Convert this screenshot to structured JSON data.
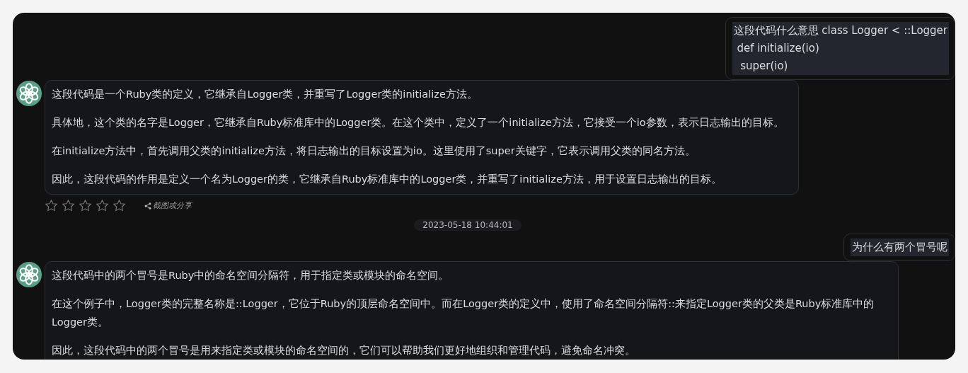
{
  "messages": [
    {
      "kind": "user",
      "text": "这段代码什么意思 class Logger < ::Logger\n def initialize(io)\n  super(io)"
    },
    {
      "kind": "assistant",
      "paragraphs": [
        "这段代码是一个Ruby类的定义，它继承自Logger类，并重写了Logger类的initialize方法。",
        "具体地，这个类的名字是Logger，它继承自Ruby标准库中的Logger类。在这个类中，定义了一个initialize方法，它接受一个io参数，表示日志输出的目标。",
        "在initialize方法中，首先调用父类的initialize方法，将日志输出的目标设置为io。这里使用了super关键字，它表示调用父类的同名方法。",
        "因此，这段代码的作用是定义一个名为Logger的类，它继承自Ruby标准库中的Logger类，并重写了initialize方法，用于设置日志输出的目标。"
      ],
      "stars": 0,
      "share": "截图或分享"
    },
    {
      "kind": "timestamp",
      "text": "2023-05-18 10:44:01"
    },
    {
      "kind": "user",
      "text": "为什么有两个冒号呢"
    },
    {
      "kind": "assistant",
      "paragraphs": [
        "这段代码中的两个冒号是Ruby中的命名空间分隔符，用于指定类或模块的命名空间。",
        "在这个例子中，Logger类的完整名称是::Logger，它位于Ruby的顶层命名空间中。而在Logger类的定义中，使用了命名空间分隔符::来指定Logger类的父类是Ruby标准库中的Logger类。",
        "因此，这段代码中的两个冒号是用来指定类或模块的命名空间的，它们可以帮助我们更好地组织和管理代码，避免命名冲突。"
      ]
    }
  ]
}
